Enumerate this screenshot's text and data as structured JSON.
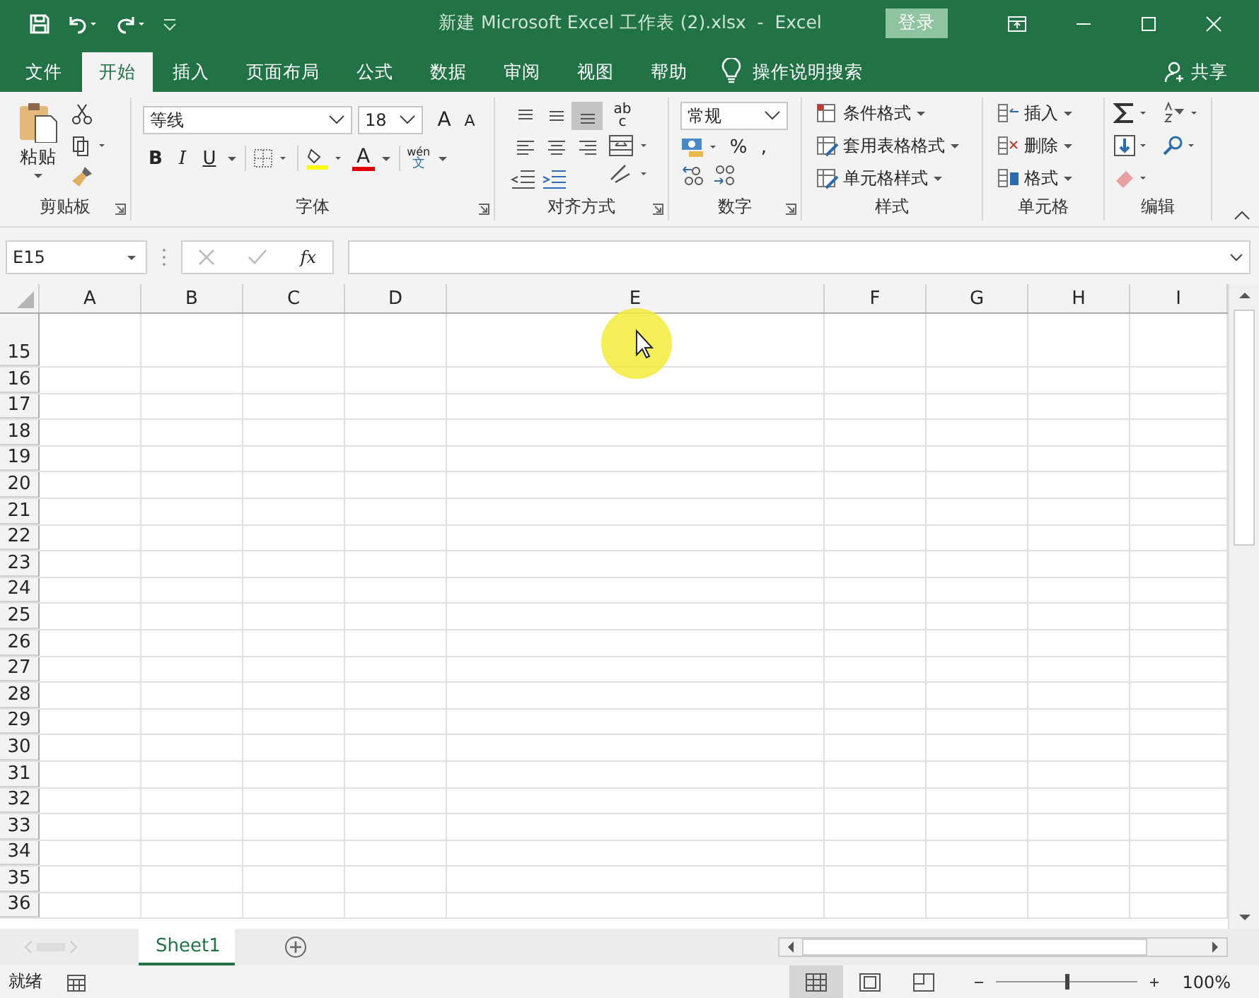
{
  "title_bar": {
    "title": "新建 Microsoft Excel 工作表 (2).xlsx  -  Excel",
    "sign_in": "登录"
  },
  "tabs": [
    {
      "label": "文件",
      "selected": false
    },
    {
      "label": "开始",
      "selected": true
    },
    {
      "label": "插入",
      "selected": false
    },
    {
      "label": "页面布局",
      "selected": false
    },
    {
      "label": "公式",
      "selected": false
    },
    {
      "label": "数据",
      "selected": false
    },
    {
      "label": "审阅",
      "selected": false
    },
    {
      "label": "视图",
      "selected": false
    },
    {
      "label": "帮助",
      "selected": false
    }
  ],
  "tell_me": "操作说明搜索",
  "share": "共享",
  "ribbon": {
    "clipboard": {
      "paste": "粘贴",
      "label": "剪贴板"
    },
    "font": {
      "name": "等线",
      "size": "18",
      "grow": "A",
      "shrink": "A",
      "bold": "B",
      "italic": "I",
      "underline": "U",
      "phonetic_top": "wén",
      "phonetic_bottom": "文",
      "font_color_letter": "A",
      "label": "字体"
    },
    "alignment": {
      "label": "对齐方式",
      "wrap_top": "ab",
      "wrap_bottom": "c",
      "buttons": [
        {
          "kind": "top",
          "selected": false
        },
        {
          "kind": "middle",
          "selected": false
        },
        {
          "kind": "bottom",
          "selected": true
        },
        {
          "kind": "left",
          "selected": false
        },
        {
          "kind": "center",
          "selected": false
        },
        {
          "kind": "right",
          "selected": false
        }
      ]
    },
    "number": {
      "format": "常规",
      "percent": "%",
      "comma": ",",
      "label": "数字"
    },
    "styles": {
      "items": [
        "条件格式",
        "套用表格格式",
        "单元格样式"
      ],
      "label": "样式"
    },
    "cells": {
      "items": [
        "插入",
        "删除",
        "格式"
      ],
      "label": "单元格"
    },
    "editing": {
      "label": "编辑"
    }
  },
  "formula_bar": {
    "name_box": "E15",
    "fx": "fx"
  },
  "columns": [
    "A",
    "B",
    "C",
    "D",
    "E",
    "F",
    "G",
    "H",
    "I"
  ],
  "rows": [
    {
      "number": "15",
      "kind": "tall"
    },
    {
      "number": "16",
      "kind": "normal"
    },
    {
      "number": "17",
      "kind": "normal"
    },
    {
      "number": "18",
      "kind": "normal"
    },
    {
      "number": "19",
      "kind": "normal"
    },
    {
      "number": "20",
      "kind": "normal"
    },
    {
      "number": "21",
      "kind": "normal"
    },
    {
      "number": "22",
      "kind": "normal"
    },
    {
      "number": "23",
      "kind": "normal"
    },
    {
      "number": "24",
      "kind": "normal"
    },
    {
      "number": "25",
      "kind": "normal"
    },
    {
      "number": "26",
      "kind": "normal"
    },
    {
      "number": "27",
      "kind": "normal"
    },
    {
      "number": "28",
      "kind": "normal"
    },
    {
      "number": "29",
      "kind": "normal"
    },
    {
      "number": "30",
      "kind": "normal"
    },
    {
      "number": "31",
      "kind": "normal"
    },
    {
      "number": "32",
      "kind": "normal"
    },
    {
      "number": "33",
      "kind": "normal"
    },
    {
      "number": "34",
      "kind": "normal"
    },
    {
      "number": "35",
      "kind": "normal"
    },
    {
      "number": "36",
      "kind": "normal"
    }
  ],
  "sheet_tabs": [
    {
      "label": "Sheet1",
      "selected": true
    }
  ],
  "status_bar": {
    "status": "就绪",
    "views": [
      {
        "kind": "normal",
        "selected": true
      },
      {
        "kind": "page_layout",
        "selected": false
      },
      {
        "kind": "page_break",
        "selected": false
      }
    ],
    "zoom_slider": {
      "level": 0.5
    },
    "zoom": "100%"
  }
}
